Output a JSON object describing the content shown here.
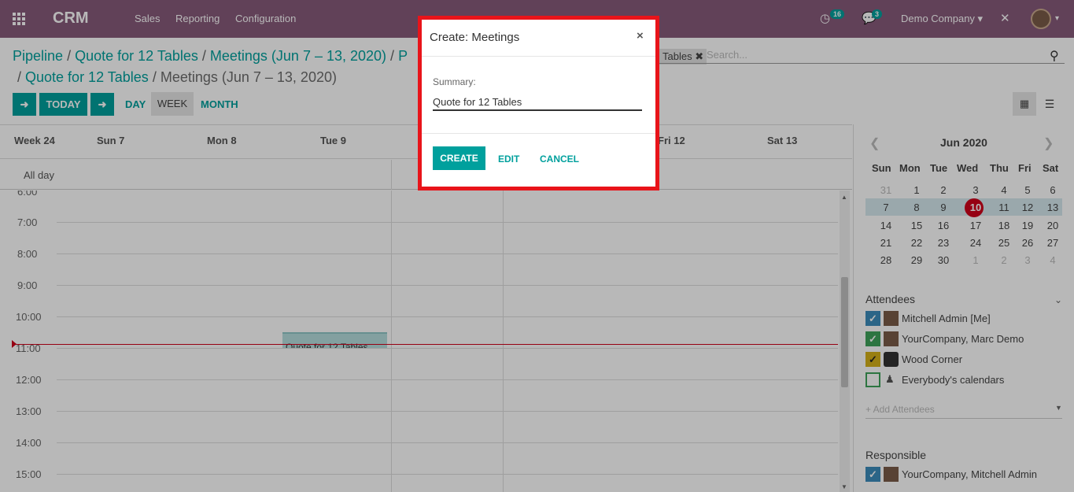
{
  "navbar": {
    "brand": "CRM",
    "menus": [
      "Sales",
      "Reporting",
      "Configuration"
    ],
    "activity_count": "16",
    "message_count": "3",
    "company": "Demo Company"
  },
  "breadcrumb": {
    "line1": [
      "Pipeline",
      "Quote for 12 Tables",
      "Meetings (Jun 7 – 13, 2020)",
      "P"
    ],
    "line2_link": "Quote for 12 Tables",
    "line2_active": "Meetings (Jun 7 – 13, 2020)"
  },
  "controls": {
    "today": "TODAY",
    "day": "DAY",
    "week": "WEEK",
    "month": "MONTH"
  },
  "search": {
    "facet": "Tables",
    "placeholder": "Search..."
  },
  "calendar": {
    "week_label": "Week 24",
    "days": [
      "Sun 7",
      "Mon 8",
      "Tue 9",
      "Fri 12",
      "Sat 13"
    ],
    "allday_label": "All day",
    "hours": [
      "6:00",
      "7:00",
      "8:00",
      "9:00",
      "10:00",
      "11:00",
      "12:00",
      "13:00",
      "14:00",
      "15:00"
    ],
    "event_title": "Quote for 12 Tables"
  },
  "mini_calendar": {
    "title": "Jun 2020",
    "dow": [
      "Sun",
      "Mon",
      "Tue",
      "Wed",
      "Thu",
      "Fri",
      "Sat"
    ],
    "weeks": [
      [
        "31",
        "1",
        "2",
        "3",
        "4",
        "5",
        "6"
      ],
      [
        "7",
        "8",
        "9",
        "10",
        "11",
        "12",
        "13"
      ],
      [
        "14",
        "15",
        "16",
        "17",
        "18",
        "19",
        "20"
      ],
      [
        "21",
        "22",
        "23",
        "24",
        "25",
        "26",
        "27"
      ],
      [
        "28",
        "29",
        "30",
        "1",
        "2",
        "3",
        "4"
      ]
    ],
    "today": "10"
  },
  "attendees": {
    "title": "Attendees",
    "items": [
      "Mitchell Admin [Me]",
      "YourCompany, Marc Demo",
      "Wood Corner",
      "Everybody's calendars"
    ],
    "add_placeholder": "+ Add Attendees"
  },
  "responsible": {
    "title": "Responsible",
    "items": [
      "YourCompany, Mitchell Admin"
    ]
  },
  "modal": {
    "title": "Create: Meetings",
    "close": "×",
    "summary_label": "Summary:",
    "summary_value": "Quote for 12 Tables",
    "create": "CREATE",
    "edit": "EDIT",
    "cancel": "CANCEL"
  },
  "colors": {
    "brand": "#875a7b",
    "accent": "#00a09d",
    "today": "#d0021b",
    "highlight": "#e8141a"
  }
}
